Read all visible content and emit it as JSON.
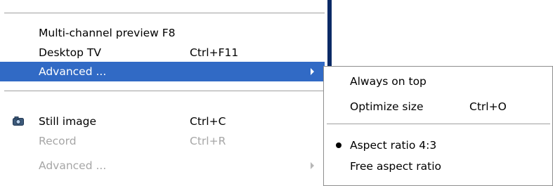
{
  "main_menu": {
    "items": [
      {
        "label": "Multi-channel preview F8",
        "shortcut": ""
      },
      {
        "label": "Desktop TV",
        "shortcut": "Ctrl+F11"
      },
      {
        "label": "Advanced ...",
        "shortcut": "",
        "state": "selected",
        "submenu": true
      },
      {
        "label": "Still image",
        "shortcut": "Ctrl+C",
        "icon": "camera-icon"
      },
      {
        "label": "Record",
        "shortcut": "Ctrl+R",
        "state": "disabled"
      },
      {
        "label": "Advanced ...",
        "shortcut": "",
        "state": "disabled",
        "submenu": true
      }
    ]
  },
  "submenu": {
    "items": [
      {
        "label": "Always on top",
        "shortcut": ""
      },
      {
        "label": "Optimize size",
        "shortcut": "Ctrl+O"
      },
      {
        "label": "Aspect ratio 4:3",
        "shortcut": "",
        "checked": true
      },
      {
        "label": "Free aspect ratio",
        "shortcut": ""
      }
    ]
  },
  "colors": {
    "selection": "#316ac5",
    "disabled_text": "#a6a6a6",
    "window_edge": "#0b2a66"
  }
}
